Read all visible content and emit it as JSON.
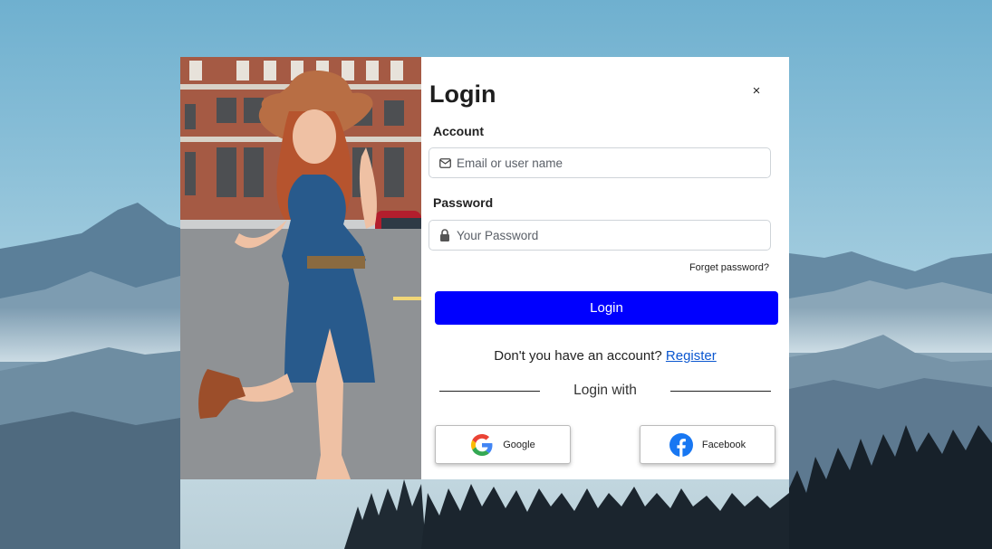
{
  "login": {
    "title": "Login",
    "close_label": "×",
    "account_label": "Account",
    "account_placeholder": "Email or user name",
    "password_label": "Password",
    "password_placeholder": "Your Password",
    "forget_password": "Forget password?",
    "submit_label": "Login",
    "register_prompt": "Don't you have an account?",
    "register_link": "Register",
    "login_with": "Login with",
    "social": [
      {
        "label": "Google",
        "icon": "google-icon"
      },
      {
        "label": "Facebook",
        "icon": "facebook-icon"
      }
    ]
  },
  "colors": {
    "accent": "#0000ff",
    "link": "#0b57d0",
    "facebook": "#1877f2"
  }
}
